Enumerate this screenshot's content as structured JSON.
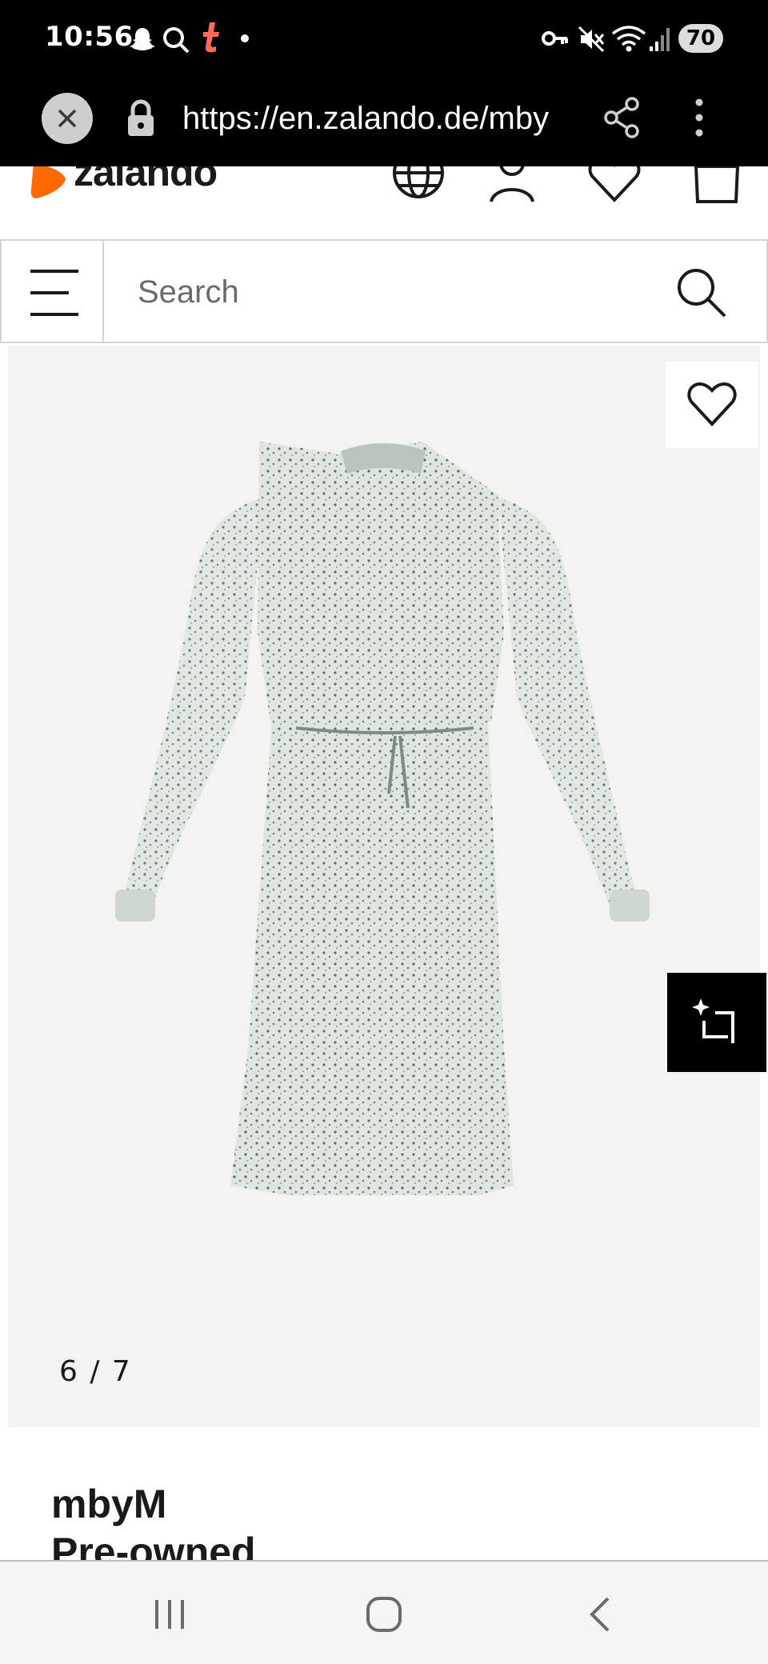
{
  "status_bar": {
    "time": "10:56",
    "battery": "70",
    "icons": [
      "snapchat-icon",
      "search-icon",
      "tumblr-icon",
      "dot-icon",
      "key-icon",
      "mute-icon",
      "wifi-icon",
      "signal-icon"
    ]
  },
  "browser": {
    "url": "https://en.zalando.de/mby",
    "icons": [
      "close-icon",
      "lock-icon",
      "share-icon",
      "more-icon"
    ]
  },
  "header": {
    "logo": "zalando",
    "accent_color": "#ff6900",
    "icons": [
      "globe-icon",
      "account-icon",
      "wishlist-icon",
      "bag-icon"
    ]
  },
  "search": {
    "placeholder": "Search"
  },
  "gallery": {
    "counter": "6 / 7",
    "image_alt": "Light green floral long-sleeve midi dress"
  },
  "product": {
    "brand": "mbyM",
    "title_partial": "Pre-owned"
  },
  "nav_bar": {
    "icons": [
      "recents-icon",
      "home-icon",
      "back-icon"
    ]
  }
}
